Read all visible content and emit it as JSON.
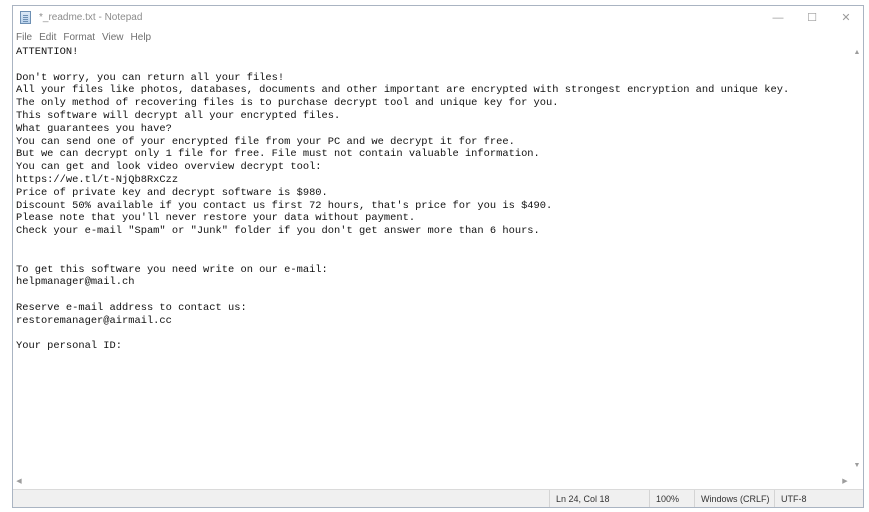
{
  "window": {
    "title": "*_readme.txt - Notepad",
    "controls": {
      "minimize": "—",
      "maximize": "☐",
      "close": "✕"
    }
  },
  "menu": [
    "File",
    "Edit",
    "Format",
    "View",
    "Help"
  ],
  "document": {
    "text": "ATTENTION!\n\nDon't worry, you can return all your files!\nAll your files like photos, databases, documents and other important are encrypted with strongest encryption and unique key.\nThe only method of recovering files is to purchase decrypt tool and unique key for you.\nThis software will decrypt all your encrypted files.\nWhat guarantees you have?\nYou can send one of your encrypted file from your PC and we decrypt it for free.\nBut we can decrypt only 1 file for free. File must not contain valuable information.\nYou can get and look video overview decrypt tool:\nhttps://we.tl/t-NjQb8RxCzz\nPrice of private key and decrypt software is $980.\nDiscount 50% available if you contact us first 72 hours, that's price for you is $490.\nPlease note that you'll never restore your data without payment.\nCheck your e-mail \"Spam\" or \"Junk\" folder if you don't get answer more than 6 hours.\n\n\nTo get this software you need write on our e-mail:\nhelpmanager@mail.ch\n\nReserve e-mail address to contact us:\nrestoremanager@airmail.cc\n\nYour personal ID:"
  },
  "statusbar": {
    "position": "Ln 24, Col 18",
    "zoom": "100%",
    "line_endings": "Windows (CRLF)",
    "encoding": "UTF-8"
  },
  "icons": {
    "app": "notepad-icon",
    "scroll_up": "▲",
    "scroll_down": "▼",
    "scroll_left": "◀",
    "scroll_right": "▶"
  }
}
